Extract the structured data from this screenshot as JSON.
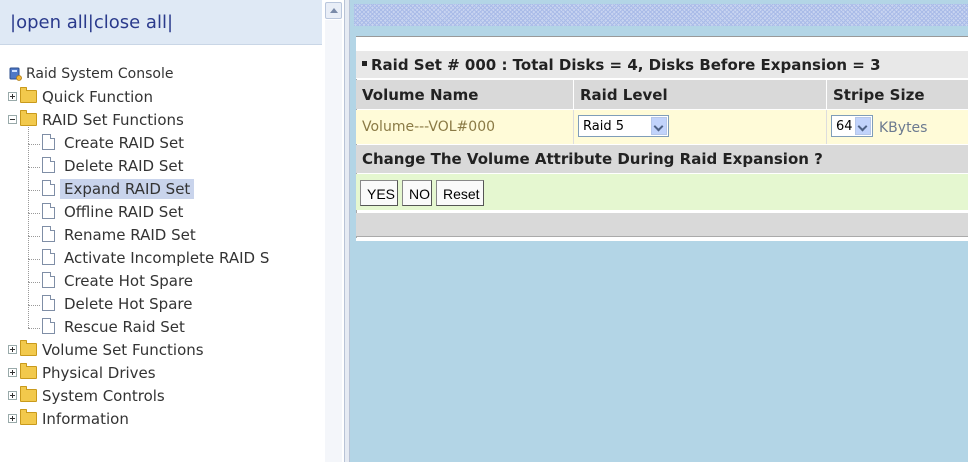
{
  "tree_header": {
    "prefix": "|",
    "open_all": "open all",
    "separator": "|",
    "close_all": "close all",
    "suffix": "|"
  },
  "tree": {
    "root": "Raid System Console",
    "quick_function": "Quick Function",
    "raid_set_functions": "RAID Set Functions",
    "raid_set_children": [
      "Create RAID Set",
      "Delete RAID Set",
      "Expand RAID Set",
      "Offline RAID Set",
      "Rename RAID Set",
      "Activate Incomplete RAID S",
      "Create Hot Spare",
      "Delete Hot Spare",
      "Rescue Raid Set"
    ],
    "selected_child": "Expand RAID Set",
    "volume_set_functions": "Volume Set Functions",
    "physical_drives": "Physical Drives",
    "system_controls": "System Controls",
    "information": "Information"
  },
  "panel": {
    "title": "Raid Set # 000 : Total Disks = 4, Disks Before Expansion = 3",
    "headers": {
      "volume_name": "Volume Name",
      "raid_level": "Raid Level",
      "stripe_size": "Stripe Size"
    },
    "row": {
      "volume_name": "Volume---VOL#000",
      "raid_level": "Raid 5",
      "stripe_size": "64",
      "stripe_unit": "KBytes"
    },
    "change_prompt": "Change The Volume Attribute During Raid Expansion ?",
    "buttons": {
      "yes": "YES",
      "no": "NO",
      "reset": "Reset"
    }
  },
  "colors": {
    "right_background": "#b3d5e6",
    "data_row": "#fffbd8",
    "button_row": "#e5f7d0",
    "selected_item": "#c9d4ec"
  },
  "icons": {
    "root": "raid-console-icon",
    "folder": "folder-icon",
    "page": "page-icon",
    "expand": "plus-icon",
    "collapse": "minus-icon"
  }
}
